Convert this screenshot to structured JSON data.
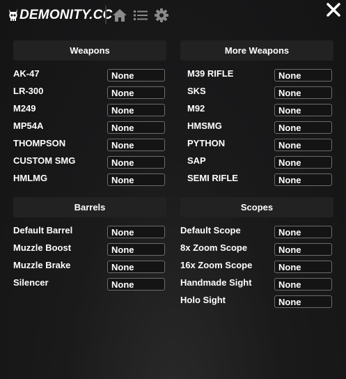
{
  "header": {
    "logo_text": "DEMONITY.CC",
    "icons": [
      "home-icon",
      "list-icon",
      "gear-icon",
      "close-icon"
    ]
  },
  "colors": {
    "background": "#1a1a1b",
    "section_bg": "#222223",
    "field_border": "#6d6d6d"
  },
  "sections": {
    "weapons": {
      "title": "Weapons",
      "items": [
        {
          "label": "AK-47",
          "value": "None"
        },
        {
          "label": "LR-300",
          "value": "None"
        },
        {
          "label": "M249",
          "value": "None"
        },
        {
          "label": "MP54A",
          "value": "None"
        },
        {
          "label": "THOMPSON",
          "value": "None"
        },
        {
          "label": "CUSTOM SMG",
          "value": "None"
        },
        {
          "label": "HMLMG",
          "value": "None"
        }
      ]
    },
    "more_weapons": {
      "title": "More Weapons",
      "items": [
        {
          "label": "M39 RIFLE",
          "value": "None"
        },
        {
          "label": "SKS",
          "value": "None"
        },
        {
          "label": "M92",
          "value": "None"
        },
        {
          "label": "HMSMG",
          "value": "None"
        },
        {
          "label": "PYTHON",
          "value": "None"
        },
        {
          "label": "SAP",
          "value": "None"
        },
        {
          "label": "SEMI RIFLE",
          "value": "None"
        }
      ]
    },
    "barrels": {
      "title": "Barrels",
      "items": [
        {
          "label": "Default Barrel",
          "value": "None"
        },
        {
          "label": "Muzzle Boost",
          "value": "None"
        },
        {
          "label": "Muzzle Brake",
          "value": "None"
        },
        {
          "label": "Silencer",
          "value": "None"
        }
      ]
    },
    "scopes": {
      "title": "Scopes",
      "items": [
        {
          "label": "Default Scope",
          "value": "None"
        },
        {
          "label": "8x Zoom Scope",
          "value": "None"
        },
        {
          "label": "16x Zoom Scope",
          "value": "None"
        },
        {
          "label": "Handmade Sight",
          "value": "None"
        },
        {
          "label": "Holo Sight",
          "value": "None"
        }
      ]
    }
  }
}
